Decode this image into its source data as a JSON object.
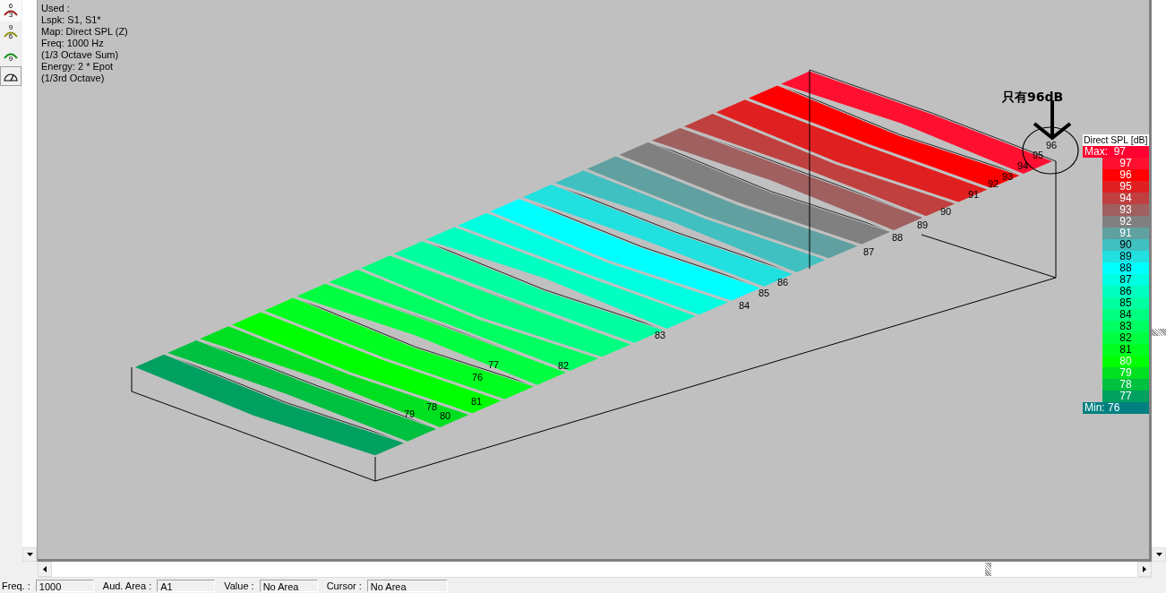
{
  "toolbar": [
    {
      "kind": "arc",
      "labels": [
        "6",
        "3"
      ],
      "color": "#a01818"
    },
    {
      "kind": "arc",
      "labels": [
        "9",
        "6"
      ],
      "color": "#909010"
    },
    {
      "kind": "arc",
      "labels": [
        "9"
      ],
      "color": "#109010"
    },
    {
      "kind": "meter"
    }
  ],
  "info_lines": [
    "Used :",
    "Lspk: S1, S1*",
    "Map: Direct SPL (Z)",
    "Freq: 1000 Hz",
    "(1/3 Octave Sum)",
    "Energy: 2 * Epot",
    "(1/3rd Octave)"
  ],
  "contour_labels": [
    "96",
    "95",
    "94",
    "93",
    "92",
    "91",
    "90",
    "89",
    "88",
    "87",
    "86",
    "85",
    "84",
    "83",
    "82",
    "77",
    "76",
    "81",
    "80",
    "79",
    "78"
  ],
  "annotation": {
    "text": "只有96dB"
  },
  "legend": {
    "title": "Direct SPL [dB]",
    "max": "Max:  97",
    "min": "Min:  76",
    "levels": [
      {
        "label": "97",
        "color": "#ff1030"
      },
      {
        "label": "96",
        "color": "#ff0000"
      },
      {
        "label": "95",
        "color": "#e02020"
      },
      {
        "label": "94",
        "color": "#c04040"
      },
      {
        "label": "93",
        "color": "#a06060"
      },
      {
        "label": "92",
        "color": "#808080"
      },
      {
        "label": "91",
        "color": "#60a0a0"
      },
      {
        "label": "90",
        "color": "#40c0c0"
      },
      {
        "label": "89",
        "color": "#20e0e0"
      },
      {
        "label": "88",
        "color": "#00ffff"
      },
      {
        "label": "87",
        "color": "#00ffe0"
      },
      {
        "label": "86",
        "color": "#00ffc0"
      },
      {
        "label": "85",
        "color": "#00ffa0"
      },
      {
        "label": "84",
        "color": "#00ff80"
      },
      {
        "label": "83",
        "color": "#00ff60"
      },
      {
        "label": "82",
        "color": "#00ff40"
      },
      {
        "label": "81",
        "color": "#00ff20"
      },
      {
        "label": "80",
        "color": "#00ff00"
      },
      {
        "label": "79",
        "color": "#00e020"
      },
      {
        "label": "78",
        "color": "#00c040"
      },
      {
        "label": "77",
        "color": "#00a060"
      }
    ]
  },
  "status_bar": [
    {
      "label": "Freq. :",
      "value": "1000"
    },
    {
      "label": "Aud. Area :",
      "value": "A1"
    },
    {
      "label": "Value :",
      "value": "No Area"
    },
    {
      "label": "Cursor :",
      "value": "No Area"
    }
  ]
}
